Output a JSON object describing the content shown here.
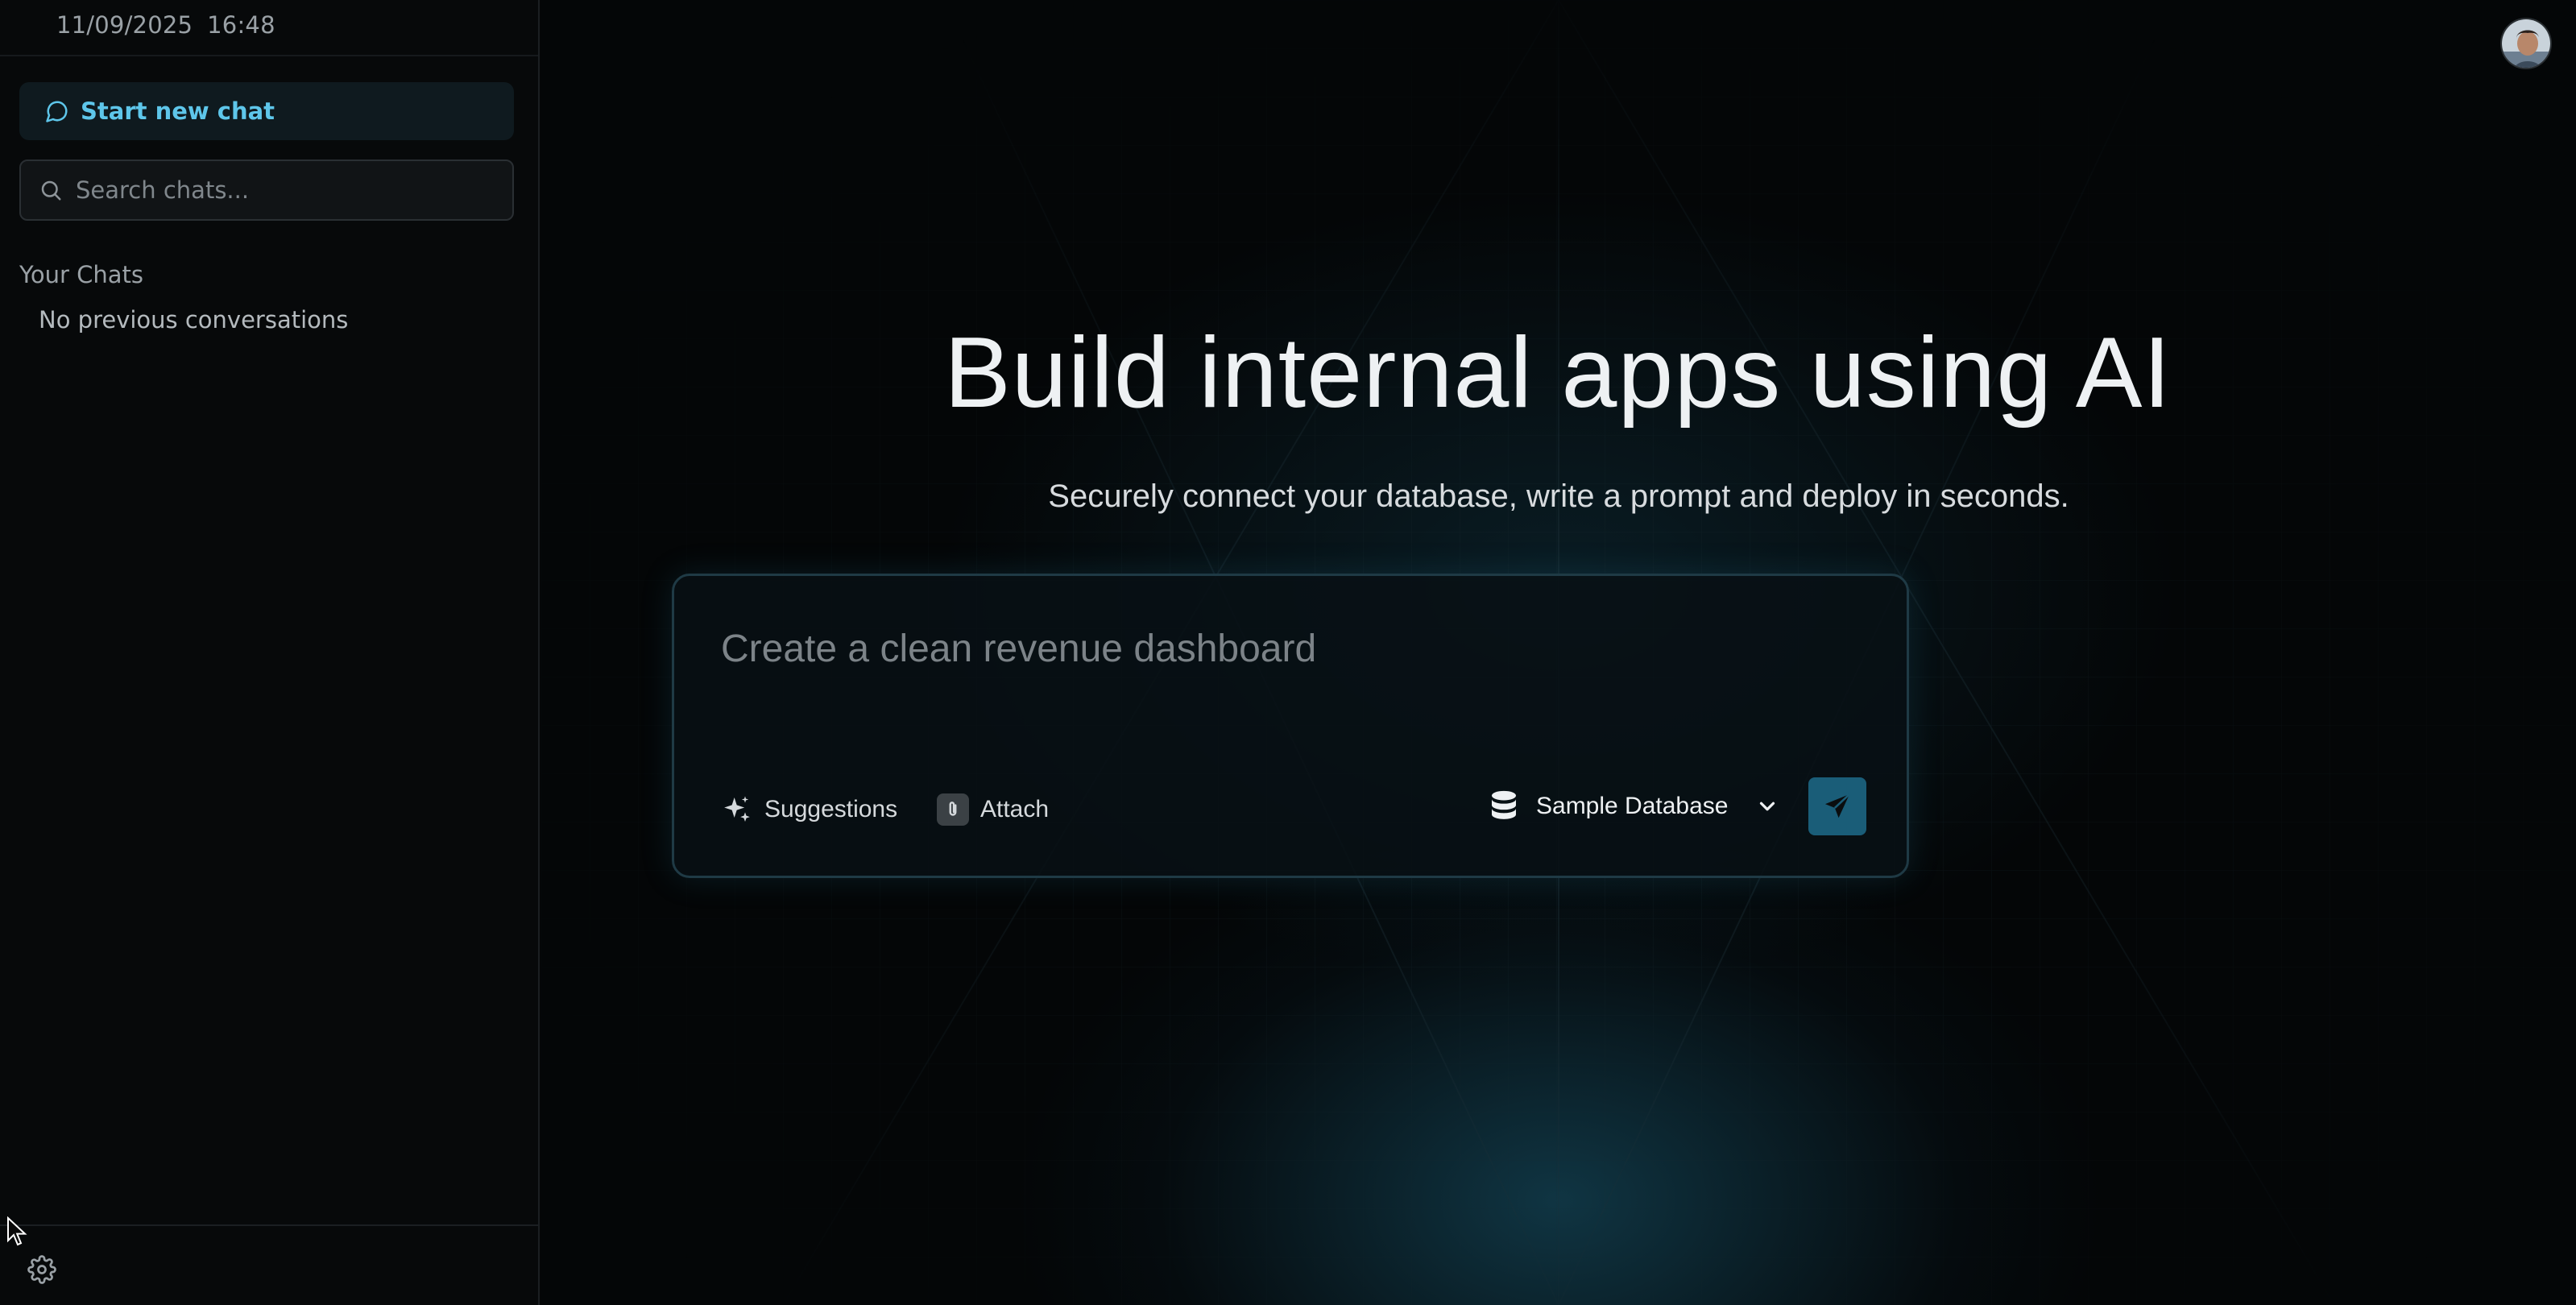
{
  "sidebar": {
    "date": "11/09/2025",
    "time": "16:48",
    "new_chat_label": "Start new chat",
    "search_placeholder": "Search chats...",
    "chats_heading": "Your Chats",
    "empty_state": "No previous conversations",
    "settings_icon": "gear-icon"
  },
  "main": {
    "title": "Build internal apps using AI",
    "subtitle": "Securely connect your database, write a prompt and deploy in seconds.",
    "prompt_placeholder": "Create a clean revenue dashboard",
    "suggestions_label": "Suggestions",
    "attach_label": "Attach",
    "database_label": "Sample Database",
    "send_icon": "send-icon"
  },
  "colors": {
    "accent": "#5ec6ea",
    "send_button": "#1a5d78",
    "background": "#050607"
  }
}
